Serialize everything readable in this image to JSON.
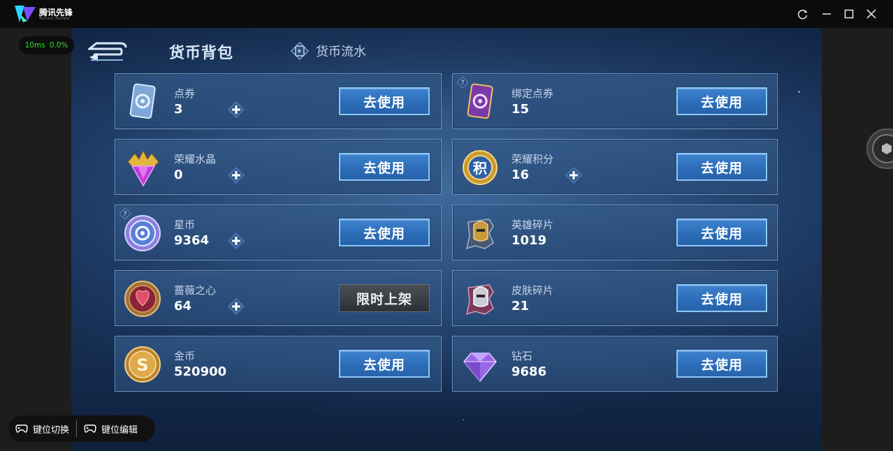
{
  "app": {
    "name": "腾讯先锋",
    "sub": "Tencent Pioneer"
  },
  "perf": {
    "latency": "10ms",
    "loss": "0.0%"
  },
  "header": {
    "title": "货币背包",
    "flow_tab": "货币流水"
  },
  "currencies": [
    {
      "name": "点券",
      "value": "3",
      "action": "去使用",
      "plus": true
    },
    {
      "name": "绑定点券",
      "value": "15",
      "action": "去使用",
      "plus": false
    },
    {
      "name": "荣耀水晶",
      "value": "0",
      "action": "去使用",
      "plus": true
    },
    {
      "name": "荣耀积分",
      "value": "16",
      "action": "去使用",
      "plus": true
    },
    {
      "name": "星币",
      "value": "9364",
      "action": "去使用",
      "plus": true
    },
    {
      "name": "英雄碎片",
      "value": "1019",
      "action": "去使用",
      "plus": false
    },
    {
      "name": "蔷薇之心",
      "value": "64",
      "action": "限时上架",
      "plus": true
    },
    {
      "name": "皮肤碎片",
      "value": "21",
      "action": "去使用",
      "plus": false
    },
    {
      "name": "金币",
      "value": "520900",
      "action": "去使用",
      "plus": false
    },
    {
      "name": "钻石",
      "value": "9686",
      "action": "去使用",
      "plus": false
    }
  ],
  "keybar": {
    "switch_label": "键位切换",
    "edit_label": "键位编辑"
  },
  "icons": {
    "voucher": "ticket-card-icon",
    "bound_voucher": "purple-ticket-card-icon",
    "crystal": "crystal-icon",
    "honor_points": "honor-points-coin-icon",
    "star_coin": "star-coin-icon",
    "hero_fragment": "hero-fragment-icon",
    "rose_heart": "rose-heart-icon",
    "skin_fragment": "skin-fragment-icon",
    "gold": "gold-coin-icon",
    "diamond": "diamond-icon"
  },
  "colors": {
    "accent": "#3e83cf",
    "button_border": "#8fc7f5",
    "perf_text": "#2de12d"
  }
}
